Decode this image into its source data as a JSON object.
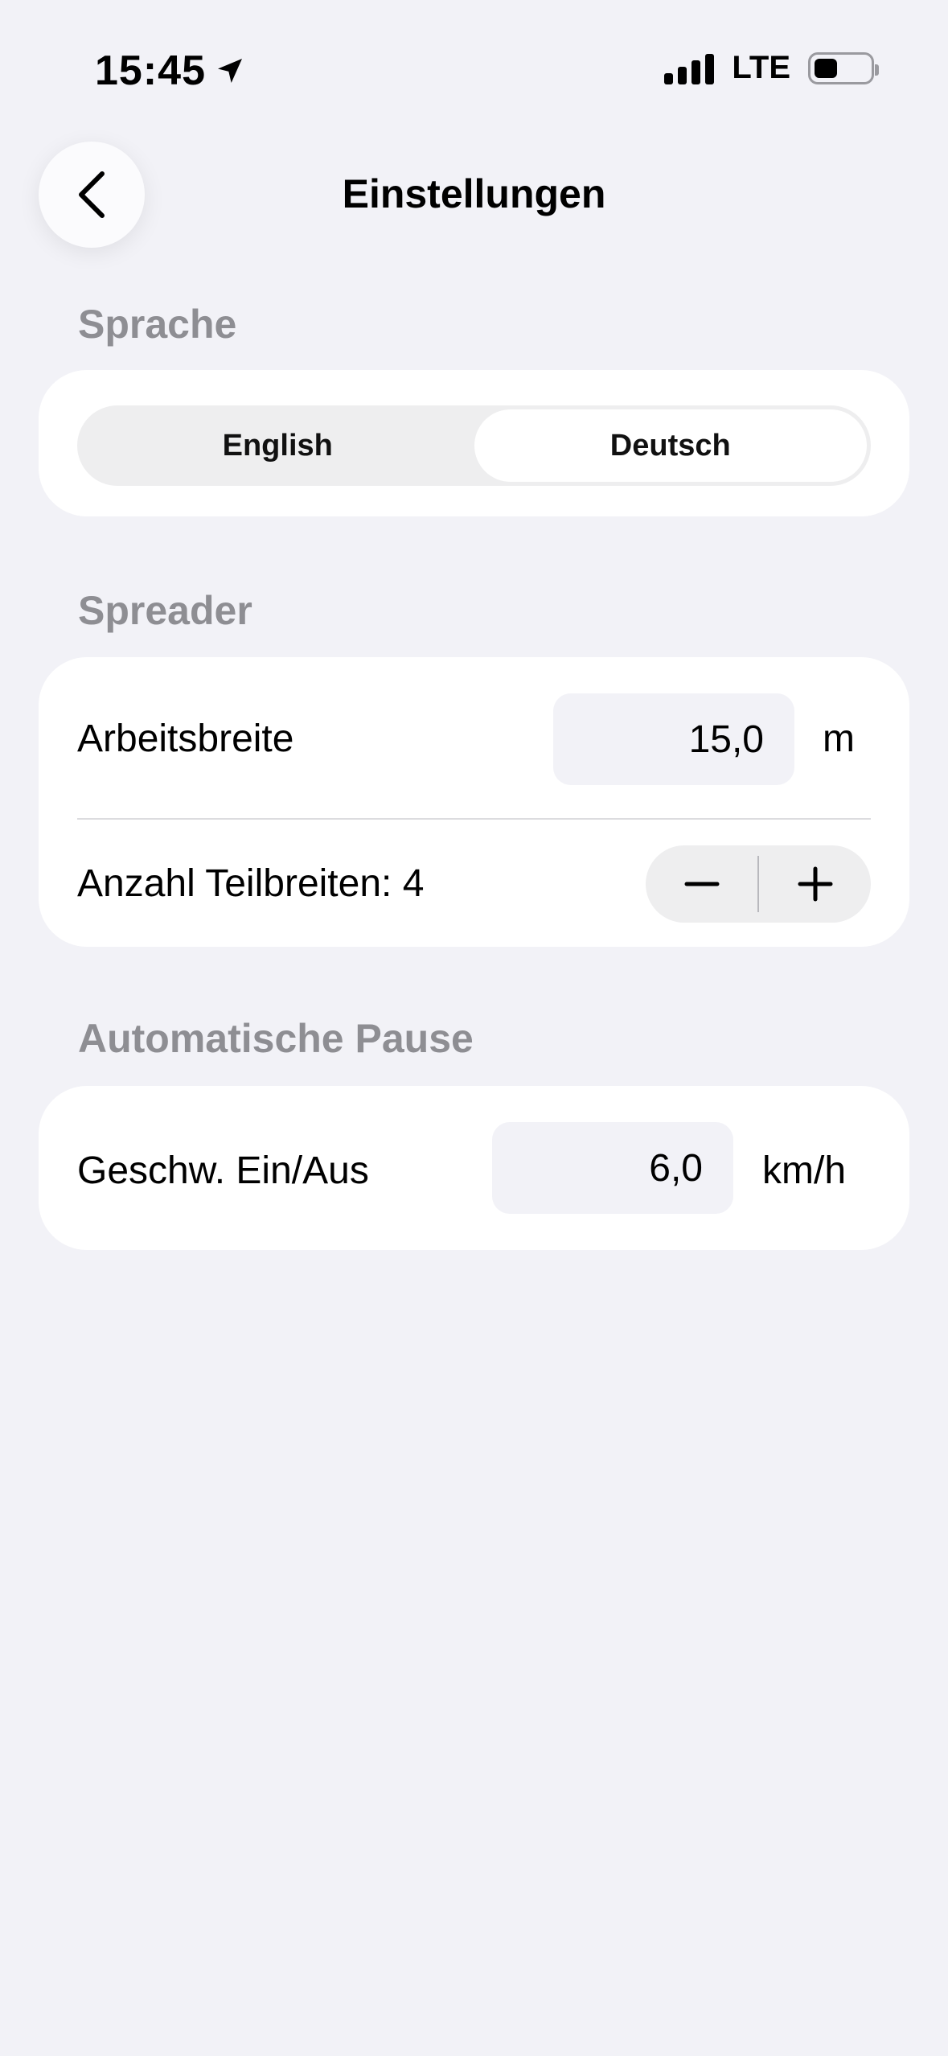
{
  "status_bar": {
    "time": "15:45",
    "network": "LTE",
    "icons": [
      "location-arrow-icon",
      "signal-bars-icon",
      "battery-icon"
    ]
  },
  "nav": {
    "title": "Einstellungen",
    "back_icon": "chevron-left-icon"
  },
  "language_section": {
    "label": "Sprache",
    "options": [
      "English",
      "Deutsch"
    ],
    "selected": "Deutsch"
  },
  "spreader_section": {
    "label": "Spreader",
    "working_width": {
      "label": "Arbeitsbreite",
      "value": "15,0",
      "unit": "m"
    },
    "sections_count": {
      "label": "Anzahl Teilbreiten: 4",
      "decrement_icon": "minus-icon",
      "increment_icon": "plus-icon"
    }
  },
  "auto_pause_section": {
    "label": "Automatische Pause",
    "speed": {
      "label": "Geschw. Ein/Aus",
      "value": "6,0",
      "unit": "km/h"
    }
  },
  "colors": {
    "background": "#f2f2f7",
    "card": "#ffffff",
    "section_label": "#8e8e93",
    "input_fill": "#f2f2f7"
  }
}
